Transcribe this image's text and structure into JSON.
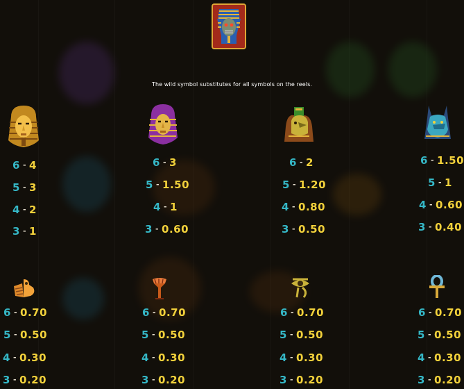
{
  "wild": {
    "icon": "wild-pharaoh-mummy-icon",
    "description": "The wild symbol substitutes for all symbols on the reels."
  },
  "colors": {
    "count": "#35b7c6",
    "value": "#f2d13b",
    "dash": "#e8e0d0"
  },
  "symbols": [
    {
      "icon": "gold-pharaoh-mask-icon",
      "pays": [
        {
          "count": "6",
          "value": "4"
        },
        {
          "count": "5",
          "value": "3"
        },
        {
          "count": "4",
          "value": "2"
        },
        {
          "count": "3",
          "value": "1"
        }
      ]
    },
    {
      "icon": "purple-pharaoh-mask-icon",
      "pays": [
        {
          "count": "6",
          "value": "3"
        },
        {
          "count": "5",
          "value": "1.50"
        },
        {
          "count": "4",
          "value": "1"
        },
        {
          "count": "3",
          "value": "0.60"
        }
      ]
    },
    {
      "icon": "green-falcon-head-icon",
      "pays": [
        {
          "count": "6",
          "value": "2"
        },
        {
          "count": "5",
          "value": "1.20"
        },
        {
          "count": "4",
          "value": "0.80"
        },
        {
          "count": "3",
          "value": "0.50"
        }
      ]
    },
    {
      "icon": "blue-anubis-head-icon",
      "pays": [
        {
          "count": "6",
          "value": "1.50"
        },
        {
          "count": "5",
          "value": "1"
        },
        {
          "count": "4",
          "value": "0.60"
        },
        {
          "count": "3",
          "value": "0.40"
        }
      ]
    },
    {
      "icon": "winged-scarab-icon",
      "pays": [
        {
          "count": "6",
          "value": "0.70"
        },
        {
          "count": "5",
          "value": "0.50"
        },
        {
          "count": "4",
          "value": "0.30"
        },
        {
          "count": "3",
          "value": "0.20"
        }
      ]
    },
    {
      "icon": "lotus-icon",
      "pays": [
        {
          "count": "6",
          "value": "0.70"
        },
        {
          "count": "5",
          "value": "0.50"
        },
        {
          "count": "4",
          "value": "0.30"
        },
        {
          "count": "3",
          "value": "0.20"
        }
      ]
    },
    {
      "icon": "eye-of-horus-icon",
      "pays": [
        {
          "count": "6",
          "value": "0.70"
        },
        {
          "count": "5",
          "value": "0.50"
        },
        {
          "count": "4",
          "value": "0.30"
        },
        {
          "count": "3",
          "value": "0.20"
        }
      ]
    },
    {
      "icon": "ankh-icon",
      "pays": [
        {
          "count": "6",
          "value": "0.70"
        },
        {
          "count": "5",
          "value": "0.50"
        },
        {
          "count": "4",
          "value": "0.30"
        },
        {
          "count": "3",
          "value": "0.20"
        }
      ]
    }
  ]
}
